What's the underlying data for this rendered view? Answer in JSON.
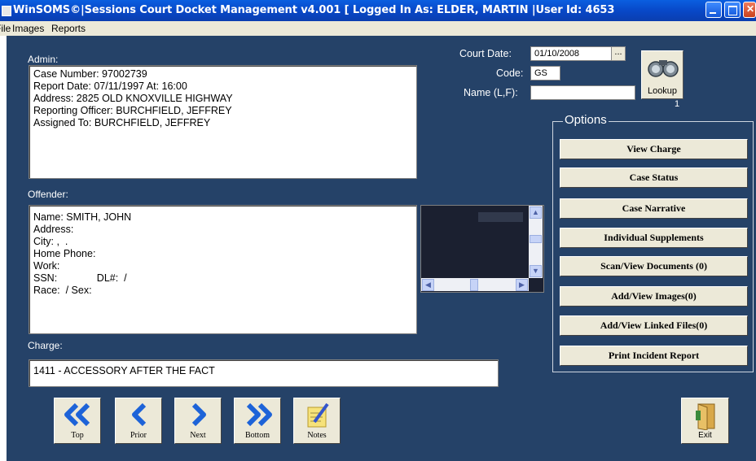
{
  "window": {
    "title": "WinSOMS©|Sessions Court Docket Management v4.001 [ Logged In As: ELDER, MARTIN  |User Id: 4653"
  },
  "menu": {
    "file": "File",
    "images": "Images",
    "reports": "Reports"
  },
  "admin": {
    "label": "Admin:",
    "lines": [
      "Case Number: 97002739",
      "Report Date: 07/11/1997 At: 16:00",
      "Address: 2825 OLD KNOXVILLE HIGHWAY",
      "Reporting Officer: BURCHFIELD, JEFFREY",
      "Assigned To: BURCHFIELD, JEFFREY"
    ]
  },
  "offender": {
    "label": "Offender:",
    "lines": [
      "Name: SMITH, JOHN",
      "Address:",
      "City: ,  .",
      "Home Phone:",
      "Work:",
      "SSN:              DL#:  /",
      "Race:  / Sex:"
    ]
  },
  "charge": {
    "label": "Charge:",
    "value": "1411 - ACCESSORY AFTER THE FACT"
  },
  "search": {
    "court_date_label": "Court Date:",
    "court_date_value": "01/10/2008",
    "code_label": "Code:",
    "code_value": "GS",
    "name_label": "Name (L,F):",
    "name_value": "",
    "ellipsis": "...",
    "lookup_label": "Lookup",
    "lookup_count": "1"
  },
  "options": {
    "title": "Options",
    "buttons": [
      "View Charge",
      "Case Status",
      "Case Narrative",
      "Individual Supplements",
      "Scan/View Documents (0)",
      "Add/View Images(0)",
      "Add/View Linked Files(0)",
      "Print Incident Report"
    ]
  },
  "nav": {
    "top": "Top",
    "prior": "Prior",
    "next": "Next",
    "bottom": "Bottom",
    "notes": "Notes",
    "exit": "Exit"
  },
  "colors": {
    "background": "#254268",
    "titlebar": "#0848c8",
    "nav_arrow": "#1d63d8"
  }
}
